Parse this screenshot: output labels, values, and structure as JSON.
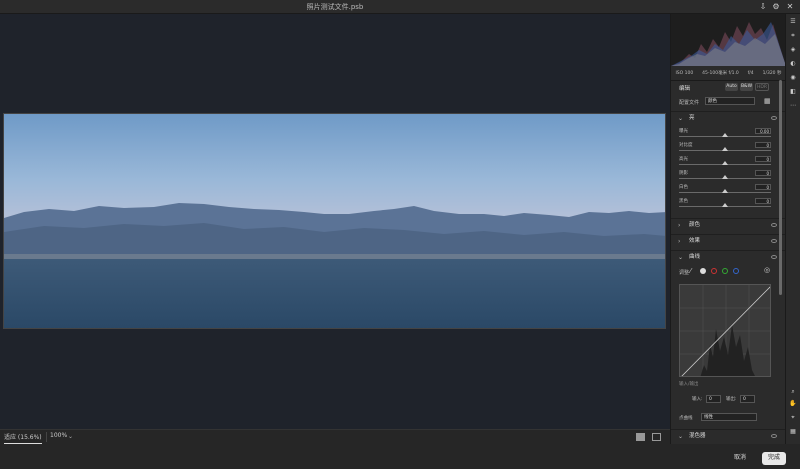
{
  "window": {
    "title": "照片测试文件.psb"
  },
  "bottom_bar": {
    "zoom_label": "适应 (15.6%)",
    "zoom_value": "100%"
  },
  "footer": {
    "cancel": "取消",
    "done": "完成"
  },
  "histogram": {
    "meta": [
      "ISO 100",
      "45-100毫米 f/1.0",
      "f/4",
      "1/320 秒"
    ]
  },
  "panel": {
    "header_label": "编辑",
    "auto": "Auto",
    "bw": "B&W",
    "hdr": "HDR",
    "profile_label": "配置文件",
    "profile_value": "颜色",
    "sections": {
      "light": "亮",
      "color": "颜色",
      "effects": "效果",
      "curves": "曲线",
      "mixer": "混色器"
    },
    "sliders": [
      {
        "label": "曝光",
        "value": "0.00"
      },
      {
        "label": "对比度",
        "value": "0"
      },
      {
        "label": "高光",
        "value": "0"
      },
      {
        "label": "阴影",
        "value": "0"
      },
      {
        "label": "白色",
        "value": "0"
      },
      {
        "label": "黑色",
        "value": "0"
      }
    ],
    "curve_mode_label": "调整",
    "curve_readout": "输入/输出",
    "input_label": "输入:",
    "input_value": "0",
    "output_label": "输出:",
    "output_value": "0",
    "point_curve_label": "点曲线",
    "point_curve_value": "线性"
  },
  "colors": {
    "accent": "#2680eb",
    "panel_bg": "#2b2b2b",
    "canvas_bg": "#1f232b",
    "done_bg": "#e8e8e8"
  }
}
